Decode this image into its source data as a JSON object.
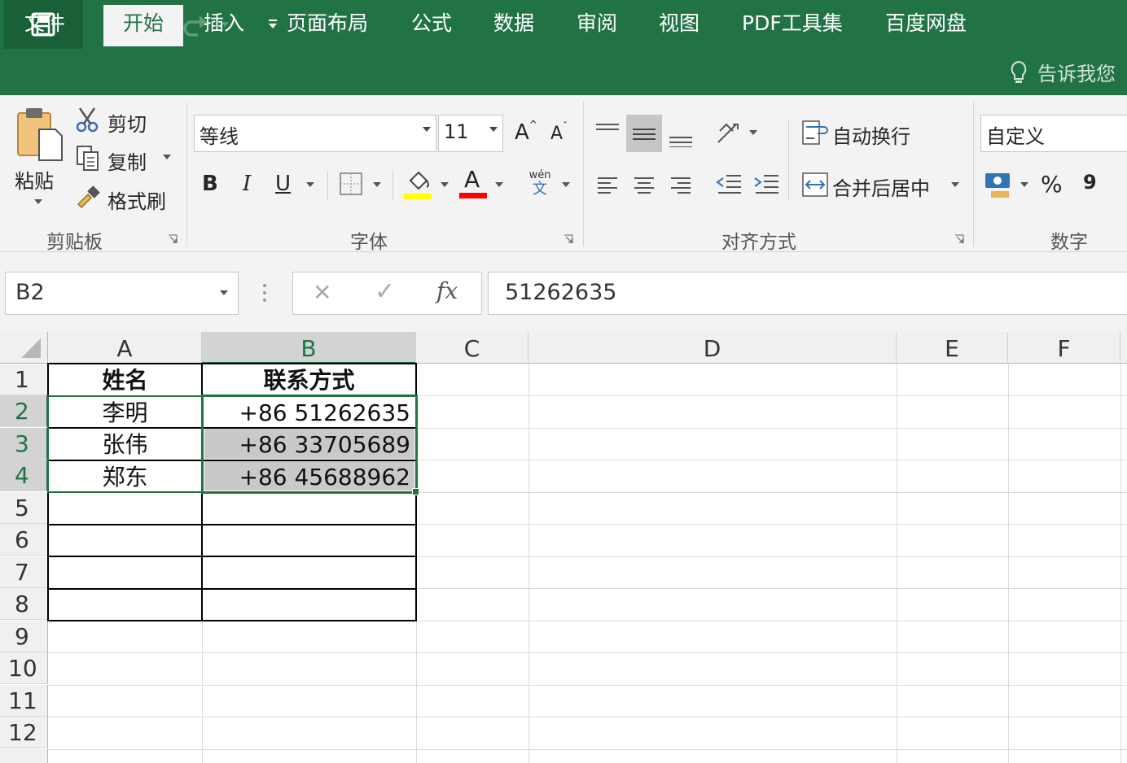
{
  "quick_access": {
    "save": "save-icon",
    "undo": "undo-icon",
    "redo": "redo-icon",
    "customize": "customize-icon"
  },
  "tabs": [
    {
      "label": "文件"
    },
    {
      "label": "开始",
      "active": true
    },
    {
      "label": "插入"
    },
    {
      "label": "页面布局"
    },
    {
      "label": "公式"
    },
    {
      "label": "数据"
    },
    {
      "label": "审阅"
    },
    {
      "label": "视图"
    },
    {
      "label": "PDF工具集"
    },
    {
      "label": "百度网盘"
    }
  ],
  "tell_me": "告诉我您",
  "clipboard": {
    "paste": "粘贴",
    "cut": "剪切",
    "copy": "复制",
    "format_painter": "格式刷",
    "group": "剪贴板"
  },
  "font": {
    "name": "等线",
    "size": "11",
    "bold": "B",
    "italic": "I",
    "underline": "U",
    "font_color_letter": "A",
    "grow": "A",
    "shrink": "A",
    "phonetic_top": "wén",
    "phonetic_bottom": "文",
    "group": "字体",
    "fill_color": "#ffff00",
    "text_color": "#ff0000"
  },
  "alignment": {
    "wrap": "自动换行",
    "merge": "合并后居中",
    "group": "对齐方式"
  },
  "number": {
    "format": "自定义",
    "percent": "%",
    "comma": "9",
    "group": "数字"
  },
  "formula_bar": {
    "name_box": "B2",
    "value": "51262635",
    "cancel": "✕",
    "enter": "✓",
    "fx": "fx"
  },
  "columns": [
    "A",
    "B",
    "C",
    "D",
    "E",
    "F"
  ],
  "rows": [
    "1",
    "2",
    "3",
    "4",
    "5",
    "6",
    "7",
    "8",
    "9",
    "10",
    "11",
    "12"
  ],
  "cells": {
    "A1": "姓名",
    "B1": "联系方式",
    "A2": "李明",
    "B2": "+86 51262635",
    "A3": "张伟",
    "B3": "+86 33705689",
    "A4": "郑东",
    "B4": "+86 45688962"
  },
  "accent_color": "#217346"
}
